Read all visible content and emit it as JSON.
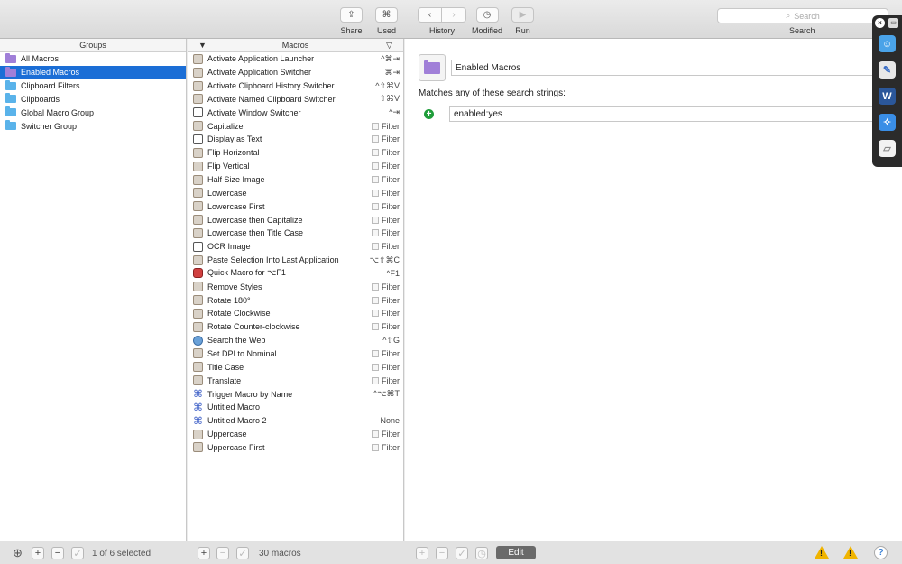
{
  "toolbar": {
    "share": {
      "icon": "share-icon",
      "glyph": "⇪",
      "label": "Share"
    },
    "used": {
      "icon": "command-icon",
      "glyph": "⌘",
      "label": "Used"
    },
    "history": {
      "back_glyph": "‹",
      "forward_glyph": "›",
      "label": "History"
    },
    "modified": {
      "glyph": "◷",
      "label": "Modified"
    },
    "run": {
      "glyph": "▶",
      "label": "Run"
    },
    "search": {
      "placeholder": "Search",
      "label": "Search",
      "glyph": "⌕"
    }
  },
  "groups": {
    "header": "Groups",
    "items": [
      {
        "label": "All Macros",
        "smart": true,
        "selected": false
      },
      {
        "label": "Enabled Macros",
        "smart": true,
        "selected": true
      },
      {
        "label": "Clipboard Filters",
        "smart": false,
        "selected": false
      },
      {
        "label": "Clipboards",
        "smart": false,
        "selected": false
      },
      {
        "label": "Global Macro Group",
        "smart": false,
        "selected": false
      },
      {
        "label": "Switcher Group",
        "smart": false,
        "selected": false
      }
    ]
  },
  "macros": {
    "header": "Macros",
    "items": [
      {
        "name": "Activate Application Launcher",
        "trigger": "^⌘⇥",
        "icon": "app"
      },
      {
        "name": "Activate Application Switcher",
        "trigger": "⌘⇥",
        "icon": "app"
      },
      {
        "name": "Activate Clipboard History Switcher",
        "trigger": "^⇧⌘V",
        "icon": "app"
      },
      {
        "name": "Activate Named Clipboard Switcher",
        "trigger": "⇧⌘V",
        "icon": "app"
      },
      {
        "name": "Activate Window Switcher",
        "trigger": "^⇥",
        "icon": "window"
      },
      {
        "name": "Capitalize",
        "trigger": "Filter",
        "icon": "app",
        "filter": true
      },
      {
        "name": "Display as Text",
        "trigger": "Filter",
        "icon": "window",
        "filter": true
      },
      {
        "name": "Flip Horizontal",
        "trigger": "Filter",
        "icon": "app",
        "filter": true
      },
      {
        "name": "Flip Vertical",
        "trigger": "Filter",
        "icon": "app",
        "filter": true
      },
      {
        "name": "Half Size Image",
        "trigger": "Filter",
        "icon": "app",
        "filter": true
      },
      {
        "name": "Lowercase",
        "trigger": "Filter",
        "icon": "app",
        "filter": true
      },
      {
        "name": "Lowercase First",
        "trigger": "Filter",
        "icon": "app",
        "filter": true
      },
      {
        "name": "Lowercase then Capitalize",
        "trigger": "Filter",
        "icon": "app",
        "filter": true
      },
      {
        "name": "Lowercase then Title Case",
        "trigger": "Filter",
        "icon": "app",
        "filter": true
      },
      {
        "name": "OCR Image",
        "trigger": "Filter",
        "icon": "window",
        "filter": true
      },
      {
        "name": "Paste Selection Into Last Application",
        "trigger": "⌥⇧⌘C",
        "icon": "app"
      },
      {
        "name": "Quick Macro for ⌥F1",
        "trigger": "^F1",
        "icon": "red"
      },
      {
        "name": "Remove Styles",
        "trigger": "Filter",
        "icon": "app",
        "filter": true
      },
      {
        "name": "Rotate 180°",
        "trigger": "Filter",
        "icon": "app",
        "filter": true
      },
      {
        "name": "Rotate Clockwise",
        "trigger": "Filter",
        "icon": "app",
        "filter": true
      },
      {
        "name": "Rotate Counter-clockwise",
        "trigger": "Filter",
        "icon": "app",
        "filter": true
      },
      {
        "name": "Search the Web",
        "trigger": "^⇧G",
        "icon": "globe"
      },
      {
        "name": "Set DPI to Nominal",
        "trigger": "Filter",
        "icon": "app",
        "filter": true
      },
      {
        "name": "Title Case",
        "trigger": "Filter",
        "icon": "app",
        "filter": true
      },
      {
        "name": "Translate",
        "trigger": "Filter",
        "icon": "app",
        "filter": true
      },
      {
        "name": "Trigger Macro by Name",
        "trigger": "^⌥⌘T",
        "icon": "cmd"
      },
      {
        "name": "Untitled Macro",
        "trigger": "",
        "icon": "cmd"
      },
      {
        "name": "Untitled Macro 2",
        "trigger": "None",
        "icon": "cmd"
      },
      {
        "name": "Uppercase",
        "trigger": "Filter",
        "icon": "app",
        "filter": true
      },
      {
        "name": "Uppercase First",
        "trigger": "Filter",
        "icon": "app",
        "filter": true
      }
    ]
  },
  "editor": {
    "group_name": "Enabled Macros",
    "matches_label": "Matches any of these search strings:",
    "add_glyph": "+",
    "search_string": "enabled:yes"
  },
  "bottombar": {
    "groups_status": "1 of 6 selected",
    "macros_status": "30 macros",
    "edit_label": "Edit",
    "add_glyph": "+",
    "remove_glyph": "−",
    "check_glyph": "✓",
    "target_glyph": "⊕",
    "clock_glyph": "◷",
    "warn_glyph": "!",
    "help_glyph": "?"
  },
  "palette": {
    "close_glyph": "×",
    "min_glyph": "▭",
    "apps": [
      {
        "name": "finder-icon",
        "glyph": "☺",
        "bg": "#4aa3e8",
        "fg": "#fff"
      },
      {
        "name": "preview-icon",
        "glyph": "✎",
        "bg": "#e8e8e8",
        "fg": "#3b6fc7"
      },
      {
        "name": "word-icon",
        "glyph": "W",
        "bg": "#2b579a",
        "fg": "#fff"
      },
      {
        "name": "safari-icon",
        "glyph": "✧",
        "bg": "#3a8ee6",
        "fg": "#fff"
      },
      {
        "name": "notes-icon",
        "glyph": "▱",
        "bg": "#f2f2f2",
        "fg": "#888"
      }
    ]
  }
}
